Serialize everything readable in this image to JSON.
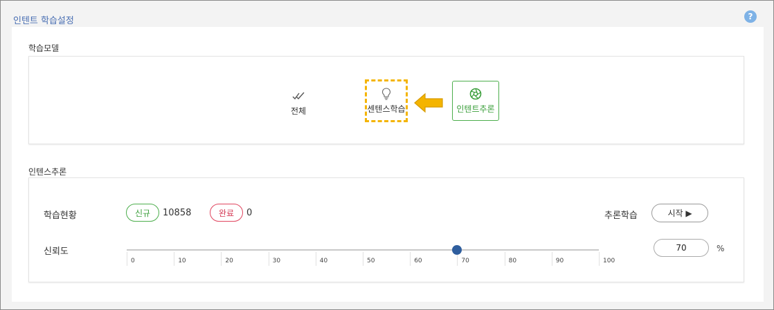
{
  "header": {
    "title": "인텐트 학습설정",
    "help_icon": "?"
  },
  "learning_model": {
    "section_label": "학습모델",
    "options": [
      {
        "label": "전체",
        "icon": "double-check-icon"
      },
      {
        "label": "센텐스학습",
        "icon": "lightbulb-icon",
        "highlighted": true
      },
      {
        "label": "인텐트추론",
        "icon": "aperture-icon",
        "selected": true
      }
    ],
    "arrow_icon": "left-arrow-icon",
    "highlight_color": "#f4b400",
    "selected_color": "#4cae4c"
  },
  "inference": {
    "section_label": "인텐스추론",
    "status_label": "학습현황",
    "new_badge": "신규",
    "new_count": "10858",
    "done_badge": "완료",
    "done_count": "0",
    "train_label": "추론학습",
    "start_label": "시작 ▶",
    "confidence_label": "신뢰도",
    "confidence_value": "70",
    "confidence_level": 70,
    "percent_unit": "%",
    "scale_ticks": [
      "0",
      "10",
      "20",
      "30",
      "40",
      "50",
      "60",
      "70",
      "80",
      "90",
      "100"
    ]
  }
}
